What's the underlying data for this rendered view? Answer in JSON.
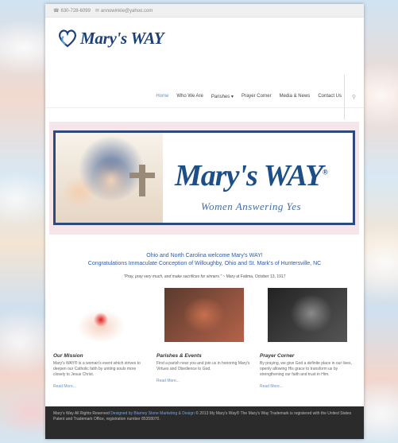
{
  "topbar": {
    "phone": "630-728-6099",
    "email": "annowinkle@yahoo.com"
  },
  "logo": {
    "text": "Mary's WAY"
  },
  "nav": {
    "items": [
      "Home",
      "Who We Are",
      "Parishes",
      "Prayer Corner",
      "Media & News",
      "Contact Us"
    ],
    "active": "Home"
  },
  "banner": {
    "title": "Mary's WAY",
    "trademark": "®",
    "subtitle": "Women Answering Yes"
  },
  "welcome": {
    "line1": "Ohio and North Carolina welcome Mary's WAY!",
    "line2": "Congratulations Immaculate Conception of Willoughby, Ohio and St. Mark's of Huntersville, NC"
  },
  "quote": {
    "text": "\"Pray, pray very much, and make sacrifices for sinners.\"",
    "attribution": " ~ Mary at Fatima, October 13, 1917"
  },
  "columns": [
    {
      "title": "Our Mission",
      "text": "Mary's WAY® is a woman's event which strives to deepen our Catholic faith by uniting souls more closely to Jesus Christ.",
      "link": "Read More..."
    },
    {
      "title": "Parishes & Events",
      "text": "Find a parish near you and join us in honoring Mary's Virtues and Obedience to God.",
      "link": "Read More..."
    },
    {
      "title": "Prayer Corner",
      "text": "By praying, we give God a definite place in our lives, openly allowing His grace to transform us by strengthening our faith and trust in Him.",
      "link": "Read More..."
    }
  ],
  "footer": {
    "prefix": "Mary's Way All Rights Reserved ",
    "designer": "Designed by Blarney Stone Marketing & Design",
    "suffix": " © 2013 My Mary's Way® The Mary's Way Trademark is registered with the United States Patent and Trademark Office, registration number 85358070."
  },
  "colors": {
    "accent": "#2f5aa6",
    "brand": "#1d4e86",
    "footer": "#2b2b2b"
  }
}
